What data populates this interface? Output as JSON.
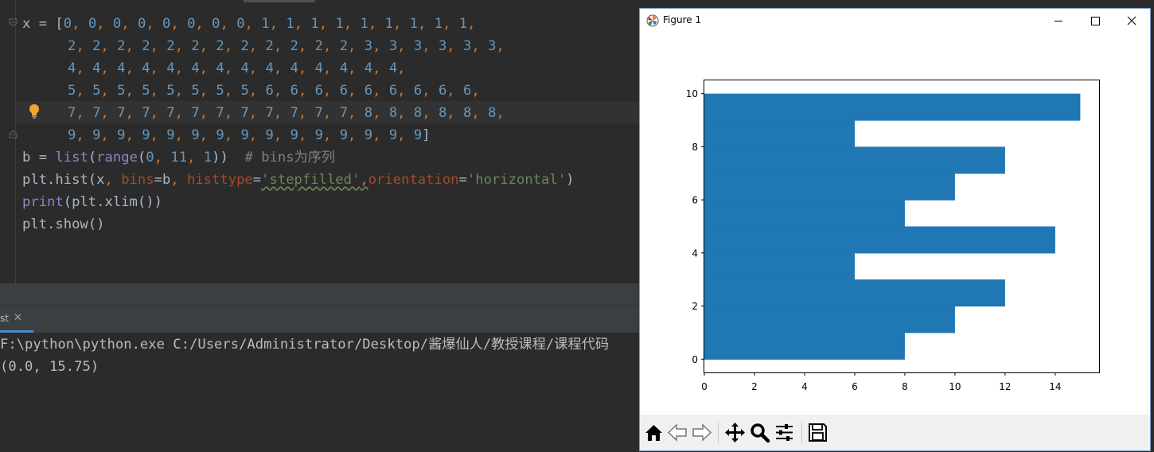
{
  "editor": {
    "lines": [
      [
        [
          "x = [",
          "d"
        ],
        [
          "0",
          "n"
        ],
        [
          ", ",
          "p"
        ],
        [
          "0",
          "n"
        ],
        [
          ", ",
          "p"
        ],
        [
          "0",
          "n"
        ],
        [
          ", ",
          "p"
        ],
        [
          "0",
          "n"
        ],
        [
          ", ",
          "p"
        ],
        [
          "0",
          "n"
        ],
        [
          ", ",
          "p"
        ],
        [
          "0",
          "n"
        ],
        [
          ", ",
          "p"
        ],
        [
          "0",
          "n"
        ],
        [
          ", ",
          "p"
        ],
        [
          "0",
          "n"
        ],
        [
          ", ",
          "p"
        ],
        [
          "1",
          "n"
        ],
        [
          ", ",
          "p"
        ],
        [
          "1",
          "n"
        ],
        [
          ", ",
          "p"
        ],
        [
          "1",
          "n"
        ],
        [
          ", ",
          "p"
        ],
        [
          "1",
          "n"
        ],
        [
          ", ",
          "p"
        ],
        [
          "1",
          "n"
        ],
        [
          ", ",
          "p"
        ],
        [
          "1",
          "n"
        ],
        [
          ", ",
          "p"
        ],
        [
          "1",
          "n"
        ],
        [
          ", ",
          "p"
        ],
        [
          "1",
          "n"
        ],
        [
          ", ",
          "p"
        ],
        [
          "1",
          "n"
        ],
        [
          ",",
          "p"
        ]
      ],
      [
        [
          "    ",
          "d"
        ],
        [
          "2",
          "n"
        ],
        [
          ", ",
          "p"
        ],
        [
          "2",
          "n"
        ],
        [
          ", ",
          "p"
        ],
        [
          "2",
          "n"
        ],
        [
          ", ",
          "p"
        ],
        [
          "2",
          "n"
        ],
        [
          ", ",
          "p"
        ],
        [
          "2",
          "n"
        ],
        [
          ", ",
          "p"
        ],
        [
          "2",
          "n"
        ],
        [
          ", ",
          "p"
        ],
        [
          "2",
          "n"
        ],
        [
          ", ",
          "p"
        ],
        [
          "2",
          "n"
        ],
        [
          ", ",
          "p"
        ],
        [
          "2",
          "n"
        ],
        [
          ", ",
          "p"
        ],
        [
          "2",
          "n"
        ],
        [
          ", ",
          "p"
        ],
        [
          "2",
          "n"
        ],
        [
          ", ",
          "p"
        ],
        [
          "2",
          "n"
        ],
        [
          ", ",
          "p"
        ],
        [
          "3",
          "n"
        ],
        [
          ", ",
          "p"
        ],
        [
          "3",
          "n"
        ],
        [
          ", ",
          "p"
        ],
        [
          "3",
          "n"
        ],
        [
          ", ",
          "p"
        ],
        [
          "3",
          "n"
        ],
        [
          ", ",
          "p"
        ],
        [
          "3",
          "n"
        ],
        [
          ", ",
          "p"
        ],
        [
          "3",
          "n"
        ],
        [
          ",",
          "p"
        ]
      ],
      [
        [
          "    ",
          "d"
        ],
        [
          "4",
          "n"
        ],
        [
          ", ",
          "p"
        ],
        [
          "4",
          "n"
        ],
        [
          ", ",
          "p"
        ],
        [
          "4",
          "n"
        ],
        [
          ", ",
          "p"
        ],
        [
          "4",
          "n"
        ],
        [
          ", ",
          "p"
        ],
        [
          "4",
          "n"
        ],
        [
          ", ",
          "p"
        ],
        [
          "4",
          "n"
        ],
        [
          ", ",
          "p"
        ],
        [
          "4",
          "n"
        ],
        [
          ", ",
          "p"
        ],
        [
          "4",
          "n"
        ],
        [
          ", ",
          "p"
        ],
        [
          "4",
          "n"
        ],
        [
          ", ",
          "p"
        ],
        [
          "4",
          "n"
        ],
        [
          ", ",
          "p"
        ],
        [
          "4",
          "n"
        ],
        [
          ", ",
          "p"
        ],
        [
          "4",
          "n"
        ],
        [
          ", ",
          "p"
        ],
        [
          "4",
          "n"
        ],
        [
          ", ",
          "p"
        ],
        [
          "4",
          "n"
        ],
        [
          ",",
          "p"
        ]
      ],
      [
        [
          "    ",
          "d"
        ],
        [
          "5",
          "n"
        ],
        [
          ", ",
          "p"
        ],
        [
          "5",
          "n"
        ],
        [
          ", ",
          "p"
        ],
        [
          "5",
          "n"
        ],
        [
          ", ",
          "p"
        ],
        [
          "5",
          "n"
        ],
        [
          ", ",
          "p"
        ],
        [
          "5",
          "n"
        ],
        [
          ", ",
          "p"
        ],
        [
          "5",
          "n"
        ],
        [
          ", ",
          "p"
        ],
        [
          "5",
          "n"
        ],
        [
          ", ",
          "p"
        ],
        [
          "5",
          "n"
        ],
        [
          ", ",
          "p"
        ],
        [
          "6",
          "n"
        ],
        [
          ", ",
          "p"
        ],
        [
          "6",
          "n"
        ],
        [
          ", ",
          "p"
        ],
        [
          "6",
          "n"
        ],
        [
          ", ",
          "p"
        ],
        [
          "6",
          "n"
        ],
        [
          ", ",
          "p"
        ],
        [
          "6",
          "n"
        ],
        [
          ", ",
          "p"
        ],
        [
          "6",
          "n"
        ],
        [
          ", ",
          "p"
        ],
        [
          "6",
          "n"
        ],
        [
          ", ",
          "p"
        ],
        [
          "6",
          "n"
        ],
        [
          ", ",
          "p"
        ],
        [
          "6",
          "n"
        ],
        [
          ",",
          "p"
        ]
      ],
      [
        [
          "    ",
          "d"
        ],
        [
          "7",
          "n"
        ],
        [
          ", ",
          "p"
        ],
        [
          "7",
          "n"
        ],
        [
          ", ",
          "p"
        ],
        [
          "7",
          "n"
        ],
        [
          ", ",
          "p"
        ],
        [
          "7",
          "n"
        ],
        [
          ", ",
          "p"
        ],
        [
          "7",
          "n"
        ],
        [
          ", ",
          "p"
        ],
        [
          "7",
          "n"
        ],
        [
          ", ",
          "p"
        ],
        [
          "7",
          "n"
        ],
        [
          ", ",
          "p"
        ],
        [
          "7",
          "n"
        ],
        [
          ", ",
          "p"
        ],
        [
          "7",
          "n"
        ],
        [
          ", ",
          "p"
        ],
        [
          "7",
          "n"
        ],
        [
          ", ",
          "p"
        ],
        [
          "7",
          "n"
        ],
        [
          ", ",
          "p"
        ],
        [
          "7",
          "n"
        ],
        [
          ", ",
          "p"
        ],
        [
          "8",
          "n"
        ],
        [
          ", ",
          "p"
        ],
        [
          "8",
          "n"
        ],
        [
          ", ",
          "p"
        ],
        [
          "8",
          "n"
        ],
        [
          ", ",
          "p"
        ],
        [
          "8",
          "n"
        ],
        [
          ", ",
          "p"
        ],
        [
          "8",
          "n"
        ],
        [
          ", ",
          "p"
        ],
        [
          "8",
          "n"
        ],
        [
          ",",
          "p"
        ]
      ],
      [
        [
          "    ",
          "d"
        ],
        [
          "9",
          "n"
        ],
        [
          ", ",
          "p"
        ],
        [
          "9",
          "n"
        ],
        [
          ", ",
          "p"
        ],
        [
          "9",
          "n"
        ],
        [
          ", ",
          "p"
        ],
        [
          "9",
          "n"
        ],
        [
          ", ",
          "p"
        ],
        [
          "9",
          "n"
        ],
        [
          ", ",
          "p"
        ],
        [
          "9",
          "n"
        ],
        [
          ", ",
          "p"
        ],
        [
          "9",
          "n"
        ],
        [
          ", ",
          "p"
        ],
        [
          "9",
          "n"
        ],
        [
          ", ",
          "p"
        ],
        [
          "9",
          "n"
        ],
        [
          ", ",
          "p"
        ],
        [
          "9",
          "n"
        ],
        [
          ", ",
          "p"
        ],
        [
          "9",
          "n"
        ],
        [
          ", ",
          "p"
        ],
        [
          "9",
          "n"
        ],
        [
          ", ",
          "p"
        ],
        [
          "9",
          "n"
        ],
        [
          ", ",
          "p"
        ],
        [
          "9",
          "n"
        ],
        [
          ", ",
          "p"
        ],
        [
          "9",
          "n"
        ],
        [
          "]",
          "d"
        ]
      ],
      [
        [
          "b = ",
          "d"
        ],
        [
          "list",
          "fn"
        ],
        [
          "(",
          "d"
        ],
        [
          "range",
          "fn"
        ],
        [
          "(",
          "d"
        ],
        [
          "0",
          "n"
        ],
        [
          ", ",
          "p"
        ],
        [
          "11",
          "n"
        ],
        [
          ", ",
          "p"
        ],
        [
          "1",
          "n"
        ],
        [
          "))  ",
          "d"
        ],
        [
          "# bins为序列",
          "c"
        ]
      ],
      [
        [
          "plt.hist(x",
          "d"
        ],
        [
          ", ",
          "p"
        ],
        [
          "bins",
          "kw"
        ],
        [
          "=b",
          "d"
        ],
        [
          ", ",
          "p"
        ],
        [
          "histtype",
          "kw"
        ],
        [
          "=",
          "d"
        ],
        [
          "'stepfilled'",
          "s wavy"
        ],
        [
          ",",
          "p wavy"
        ],
        [
          "orientation",
          "kw"
        ],
        [
          "=",
          "d"
        ],
        [
          "'horizontal'",
          "s"
        ],
        [
          ")",
          "d"
        ]
      ],
      [
        [
          "print",
          "fn"
        ],
        [
          "(plt.xlim())",
          "d"
        ]
      ],
      [
        [
          "plt.show()",
          "d"
        ]
      ]
    ]
  },
  "run_panel": {
    "tab_label": "st",
    "close_glyph": "✕",
    "output_lines": [
      "F:\\python\\python.exe C:/Users/Administrator/Desktop/酱爆仙人/教授课程/课程代码",
      "(0.0, 15.75)"
    ]
  },
  "figure_window": {
    "title": "Figure 1"
  },
  "colors": {
    "bar_fill": "#1f77b4",
    "ide_bg": "#2b2b2b"
  },
  "chart_data": {
    "type": "bar",
    "orientation": "horizontal",
    "histtype": "stepfilled",
    "bin_edges": [
      0,
      1,
      2,
      3,
      4,
      5,
      6,
      7,
      8,
      9,
      10
    ],
    "values": [
      8,
      10,
      12,
      6,
      14,
      8,
      10,
      12,
      6,
      15
    ],
    "xlim": [
      0,
      15.75
    ],
    "ylim": [
      -0.5,
      10.5
    ],
    "xticks": [
      0,
      2,
      4,
      6,
      8,
      10,
      12,
      14
    ],
    "yticks": [
      0,
      2,
      4,
      6,
      8,
      10
    ],
    "title": "",
    "xlabel": "",
    "ylabel": "",
    "grid": false
  }
}
